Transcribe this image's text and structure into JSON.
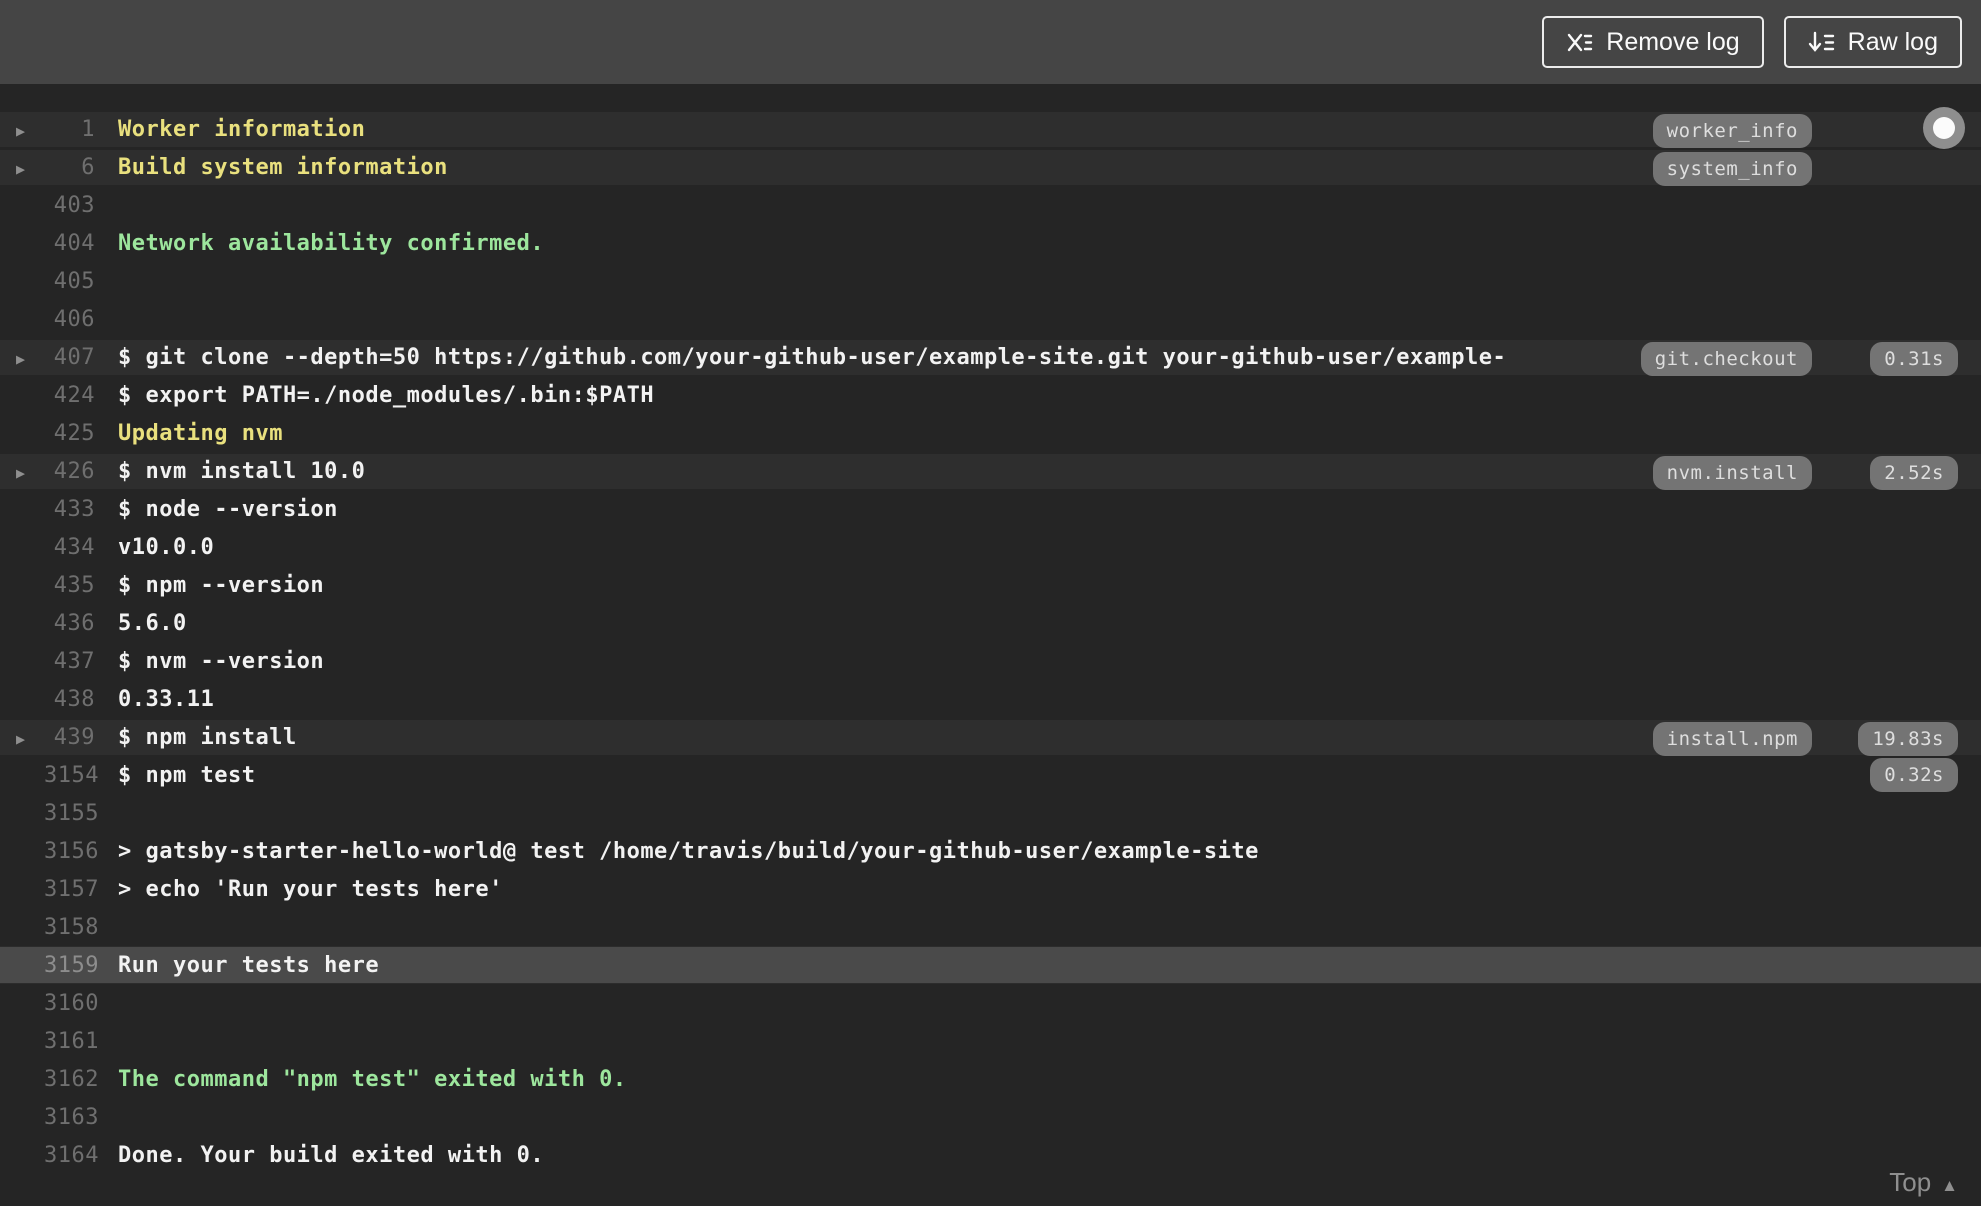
{
  "toolbar": {
    "remove_log_label": "Remove log",
    "raw_log_label": "Raw log"
  },
  "footer": {
    "top_label": "Top"
  },
  "colors": {
    "toolbar_bg": "#454545",
    "log_bg": "#252525",
    "folded_row_bg": "#2e2e2e",
    "highlight_row_bg": "#4a4a4a",
    "yellow_text": "#e9e07e",
    "green_text": "#9de69d",
    "plain_text": "#f2f2f2",
    "badge_bg": "#747474"
  },
  "log": {
    "rows": [
      {
        "num": "1",
        "text": "Worker information",
        "style": "yellow",
        "arrow": true,
        "folded": true,
        "highlight": false,
        "tag": "worker_info",
        "duration": null
      },
      {
        "num": "6",
        "text": "Build system information",
        "style": "yellow",
        "arrow": true,
        "folded": true,
        "highlight": false,
        "tag": "system_info",
        "duration": null
      },
      {
        "num": "403",
        "text": "",
        "style": "plain",
        "arrow": false,
        "folded": false,
        "highlight": false,
        "tag": null,
        "duration": null
      },
      {
        "num": "404",
        "text": "Network availability confirmed.",
        "style": "green",
        "arrow": false,
        "folded": false,
        "highlight": false,
        "tag": null,
        "duration": null
      },
      {
        "num": "405",
        "text": "",
        "style": "plain",
        "arrow": false,
        "folded": false,
        "highlight": false,
        "tag": null,
        "duration": null
      },
      {
        "num": "406",
        "text": "",
        "style": "plain",
        "arrow": false,
        "folded": false,
        "highlight": false,
        "tag": null,
        "duration": null
      },
      {
        "num": "407",
        "text": "$ git clone --depth=50 https://github.com/your-github-user/example-site.git your-github-user/example-",
        "style": "plain",
        "arrow": true,
        "folded": true,
        "highlight": false,
        "tag": "git.checkout",
        "duration": "0.31s"
      },
      {
        "num": "424",
        "text": "$ export PATH=./node_modules/.bin:$PATH",
        "style": "plain",
        "arrow": false,
        "folded": false,
        "highlight": false,
        "tag": null,
        "duration": null
      },
      {
        "num": "425",
        "text": "Updating nvm",
        "style": "yellow",
        "arrow": false,
        "folded": false,
        "highlight": false,
        "tag": null,
        "duration": null
      },
      {
        "num": "426",
        "text": "$ nvm install 10.0",
        "style": "plain",
        "arrow": true,
        "folded": true,
        "highlight": false,
        "tag": "nvm.install",
        "duration": "2.52s"
      },
      {
        "num": "433",
        "text": "$ node --version",
        "style": "plain",
        "arrow": false,
        "folded": false,
        "highlight": false,
        "tag": null,
        "duration": null
      },
      {
        "num": "434",
        "text": "v10.0.0",
        "style": "plain",
        "arrow": false,
        "folded": false,
        "highlight": false,
        "tag": null,
        "duration": null
      },
      {
        "num": "435",
        "text": "$ npm --version",
        "style": "plain",
        "arrow": false,
        "folded": false,
        "highlight": false,
        "tag": null,
        "duration": null
      },
      {
        "num": "436",
        "text": "5.6.0",
        "style": "plain",
        "arrow": false,
        "folded": false,
        "highlight": false,
        "tag": null,
        "duration": null
      },
      {
        "num": "437",
        "text": "$ nvm --version",
        "style": "plain",
        "arrow": false,
        "folded": false,
        "highlight": false,
        "tag": null,
        "duration": null
      },
      {
        "num": "438",
        "text": "0.33.11",
        "style": "plain",
        "arrow": false,
        "folded": false,
        "highlight": false,
        "tag": null,
        "duration": null
      },
      {
        "num": "439",
        "text": "$ npm install",
        "style": "plain",
        "arrow": true,
        "folded": true,
        "highlight": false,
        "tag": "install.npm",
        "duration": "19.83s"
      },
      {
        "num": "3154",
        "text": "$ npm test",
        "style": "plain",
        "arrow": false,
        "folded": false,
        "highlight": false,
        "tag": null,
        "duration": "0.32s"
      },
      {
        "num": "3155",
        "text": "",
        "style": "plain",
        "arrow": false,
        "folded": false,
        "highlight": false,
        "tag": null,
        "duration": null
      },
      {
        "num": "3156",
        "text": "> gatsby-starter-hello-world@ test /home/travis/build/your-github-user/example-site",
        "style": "plain",
        "arrow": false,
        "folded": false,
        "highlight": false,
        "tag": null,
        "duration": null
      },
      {
        "num": "3157",
        "text": "> echo 'Run your tests here'",
        "style": "plain",
        "arrow": false,
        "folded": false,
        "highlight": false,
        "tag": null,
        "duration": null
      },
      {
        "num": "3158",
        "text": "",
        "style": "plain",
        "arrow": false,
        "folded": false,
        "highlight": false,
        "tag": null,
        "duration": null
      },
      {
        "num": "3159",
        "text": "Run your tests here",
        "style": "plain",
        "arrow": false,
        "folded": false,
        "highlight": true,
        "tag": null,
        "duration": null
      },
      {
        "num": "3160",
        "text": "",
        "style": "plain",
        "arrow": false,
        "folded": false,
        "highlight": false,
        "tag": null,
        "duration": null
      },
      {
        "num": "3161",
        "text": "",
        "style": "plain",
        "arrow": false,
        "folded": false,
        "highlight": false,
        "tag": null,
        "duration": null
      },
      {
        "num": "3162",
        "text": "The command \"npm test\" exited with 0.",
        "style": "green",
        "arrow": false,
        "folded": false,
        "highlight": false,
        "tag": null,
        "duration": null
      },
      {
        "num": "3163",
        "text": "",
        "style": "plain",
        "arrow": false,
        "folded": false,
        "highlight": false,
        "tag": null,
        "duration": null
      },
      {
        "num": "3164",
        "text": "Done. Your build exited with 0.",
        "style": "plain",
        "arrow": false,
        "folded": false,
        "highlight": false,
        "tag": null,
        "duration": null
      }
    ]
  }
}
